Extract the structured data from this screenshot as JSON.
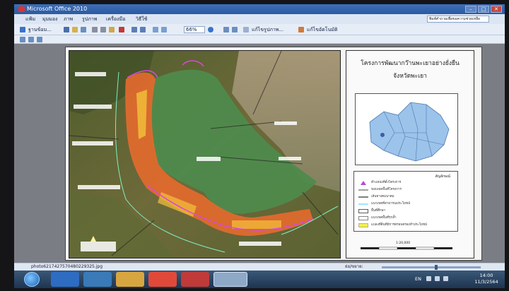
{
  "window": {
    "title": "Microsoft Office 2010",
    "controls": [
      "–",
      "□",
      "✕"
    ]
  },
  "menu": {
    "items": [
      "แฟ้ม",
      "มุมมอง",
      "ภาพ",
      "รูปภาพ",
      "เครื่องมือ",
      "วิธีใช้"
    ]
  },
  "help_box": {
    "placeholder": "พิมพ์คำถามเพื่อขอความช่วยเหลือ"
  },
  "toolbar": {
    "share_label": "ฐานข้อม...",
    "zoom_value": "66%",
    "edit_pictures_label": "แก้ไขรูปภาพ...",
    "auto_correct_label": "แก้ไขอัตโนมัติ"
  },
  "document": {
    "panel_title_line1": "โครงการพัฒนากว๊านพะเยาอย่างยั่งยืน",
    "panel_title_line2": "จังหวัดพะเยา",
    "legend_heading": "สัญลักษณ์",
    "legend_items": [
      {
        "text": "ตำแหน่งที่ตั้งโครงการ",
        "color": "#b44ad6"
      },
      {
        "text": "ขอบเขตพื้นที่โครงการ",
        "color": "#444444"
      },
      {
        "text": "เส้นทางคมนาคม",
        "color": "#555555"
      },
      {
        "text": "แนวเขตที่สาธารณประโยชน์",
        "color": "#7fdfff"
      },
      {
        "text": "พื้นที่ศึกษา",
        "color": "#ffffff"
      },
      {
        "text": "แนวเขตพื้นที่รุกล้ำ",
        "color": "#666666"
      },
      {
        "text": "แปลงที่ดินที่มีการครอบครองทำประโยชน์",
        "color": "#f3f04a"
      }
    ],
    "scale_text": "1:20,000",
    "colors": {
      "lake": "#4f8a4c",
      "encroachment": "#e56a2e",
      "province_fill": "#9cc3ea",
      "boundary": "#d64ad6"
    }
  },
  "status": {
    "filename": "photo6217427570480229325.jpg",
    "zoom_label": "ย่อ/ขยาย:",
    "zoom_level": 0.55
  },
  "taskbar": {
    "language": "EN",
    "time": "14:00",
    "date": "11/3/2564"
  }
}
